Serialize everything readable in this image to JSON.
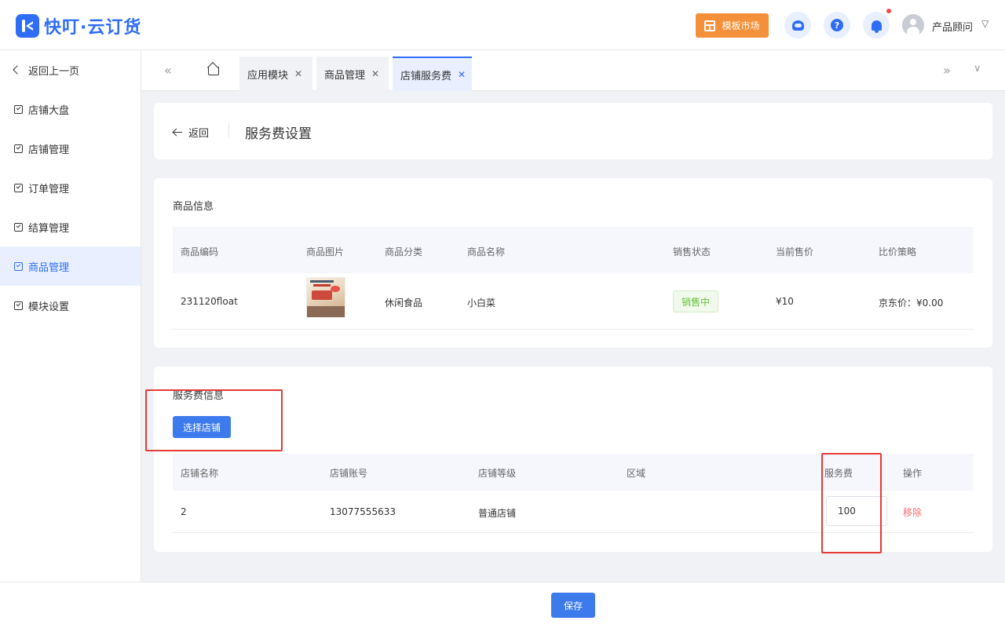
{
  "app": {
    "title": "快叮·云订货"
  },
  "header": {
    "market_label": "模板市场",
    "user_name": "产品顾问",
    "icons": [
      "customer-service-icon",
      "help-icon",
      "bell-icon",
      "avatar",
      "chevron-down-icon"
    ],
    "colors": {
      "brand": "#2f6df6",
      "market": "#f5903a",
      "notify_dot": "#f5484d"
    }
  },
  "sidebar": {
    "back_label": "返回上一页",
    "items": [
      {
        "label": "店铺大盘",
        "active": false
      },
      {
        "label": "店铺管理",
        "active": false
      },
      {
        "label": "订单管理",
        "active": false
      },
      {
        "label": "结算管理",
        "active": false
      },
      {
        "label": "商品管理",
        "active": true
      },
      {
        "label": "模块设置",
        "active": false
      }
    ]
  },
  "tabs": [
    {
      "label": "应用模块",
      "active": false
    },
    {
      "label": "商品管理",
      "active": false
    },
    {
      "label": "店铺服务费",
      "active": true
    }
  ],
  "page": {
    "back_label": "返回",
    "title": "服务费设置"
  },
  "product": {
    "section_title": "商品信息",
    "columns": [
      "商品编码",
      "商品图片",
      "商品分类",
      "商品名称",
      "销售状态",
      "当前售价",
      "比价策略"
    ],
    "row": {
      "code": "231120float",
      "category": "休闲食品",
      "name": "小白菜",
      "status": "销售中",
      "price": "¥10",
      "strategy": "京东价：¥0.00"
    }
  },
  "service_fee": {
    "section_title": "服务费信息",
    "select_button": "选择店铺",
    "columns": [
      "店铺名称",
      "店铺账号",
      "店铺等级",
      "区域",
      "服务费",
      "操作"
    ],
    "row": {
      "shop_name": "2",
      "account": "13077555633",
      "level": "普通店铺",
      "region": "",
      "fee": "100",
      "action": "移除"
    }
  },
  "footer": {
    "save_label": "保存"
  }
}
